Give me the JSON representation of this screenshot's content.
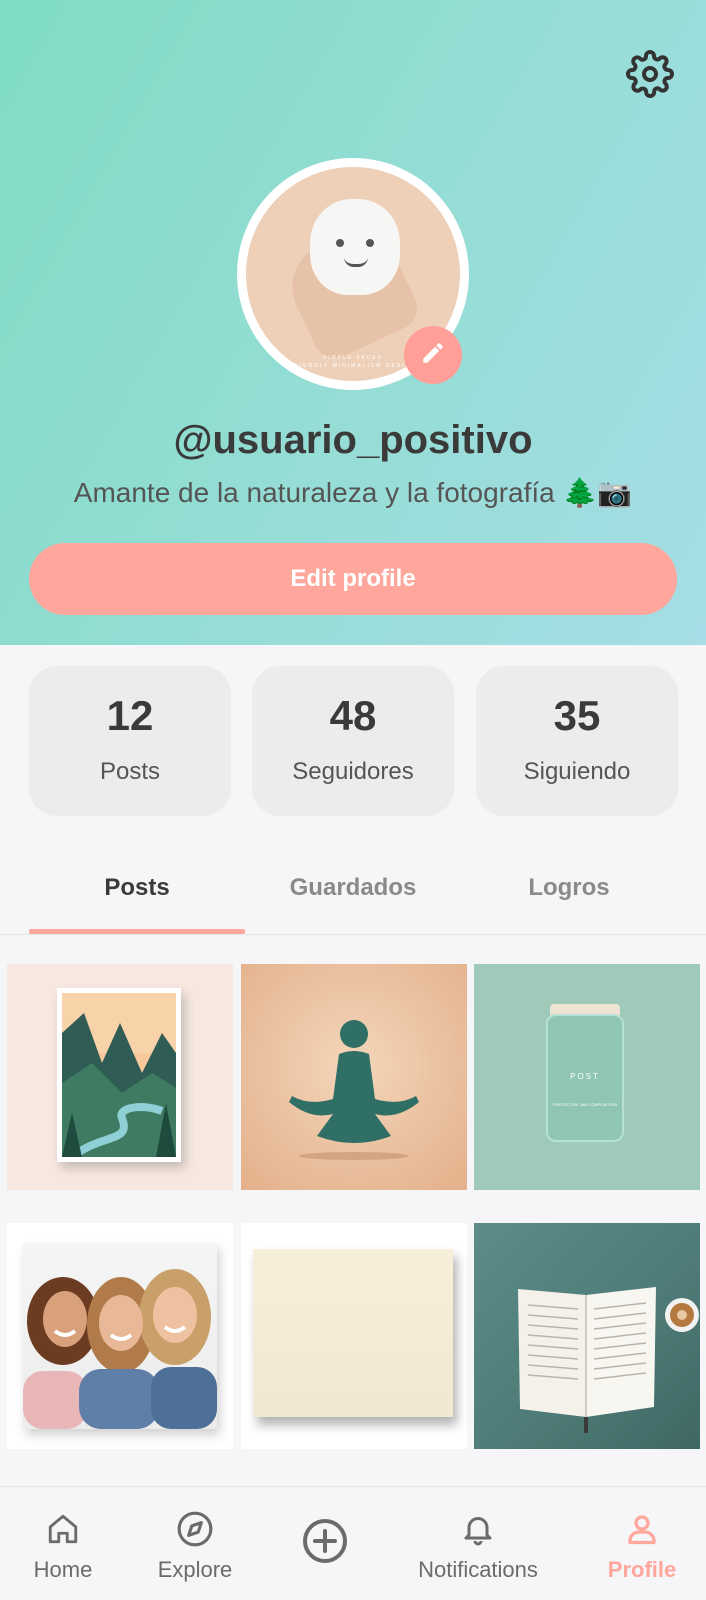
{
  "profile": {
    "username": "@usuario_positivo",
    "bio": "Amante de la naturaleza y la fotografía 🌲📷",
    "edit_label": "Edit profile",
    "avatar_caption_1": "SIMPLE FACES",
    "avatar_caption_2": "FRIENDLY MINIMALISM DESIGN"
  },
  "stats": [
    {
      "value": "12",
      "label": "Posts"
    },
    {
      "value": "48",
      "label": "Seguidores"
    },
    {
      "value": "35",
      "label": "Siguiendo"
    }
  ],
  "tabs": [
    {
      "label": "Posts",
      "active": true
    },
    {
      "label": "Guardados",
      "active": false
    },
    {
      "label": "Logros",
      "active": false
    }
  ],
  "posts": {
    "jar_title": "POST",
    "jar_subtitle": "PROTECTIVE JAR COMPOSITION",
    "items": [
      {
        "name": "mountain-poster"
      },
      {
        "name": "meditation"
      },
      {
        "name": "glass-jar"
      },
      {
        "name": "friends-photo"
      },
      {
        "name": "blank-paper"
      },
      {
        "name": "open-book-coffee"
      }
    ]
  },
  "nav": [
    {
      "label": "Home",
      "icon": "home-icon",
      "active": false
    },
    {
      "label": "Explore",
      "icon": "compass-icon",
      "active": false
    },
    {
      "label": "",
      "icon": "plus-circle-icon",
      "active": false
    },
    {
      "label": "Notifications",
      "icon": "bell-icon",
      "active": false
    },
    {
      "label": "Profile",
      "icon": "user-icon",
      "active": true
    }
  ],
  "colors": {
    "accent": "#ffa79d",
    "header_start": "#7fdcc4",
    "header_end": "#a6dde6",
    "text_dark": "#3a3a3a"
  }
}
